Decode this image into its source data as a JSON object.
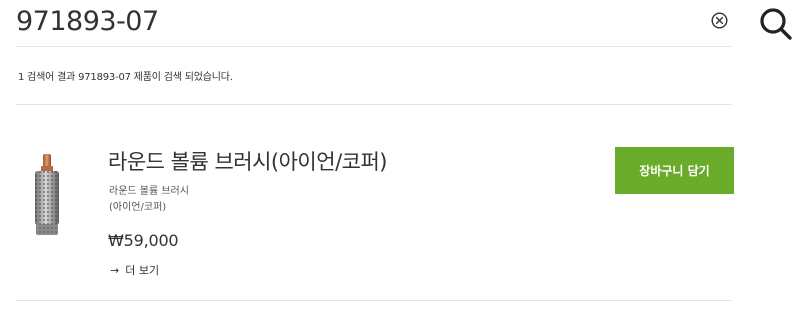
{
  "search": {
    "query": "971893-07",
    "result_summary": "1 검색어 결과 971893-07 제품이 검색 되었습니다."
  },
  "product": {
    "title": "라운드 볼륨 브러시(아이언/코퍼)",
    "desc_line1": "라운드 볼륨 브러시",
    "desc_line2": "(아이언/코퍼)",
    "price": "₩59,000",
    "more_label": "더 보기",
    "add_to_cart_label": "장바구니 담기"
  },
  "colors": {
    "accent_green": "#6bab2a",
    "text": "#333333",
    "divider": "#e3e3e3"
  },
  "icons": {
    "clear": "close-circle-icon",
    "search": "search-icon",
    "more": "arrow-right-icon"
  }
}
